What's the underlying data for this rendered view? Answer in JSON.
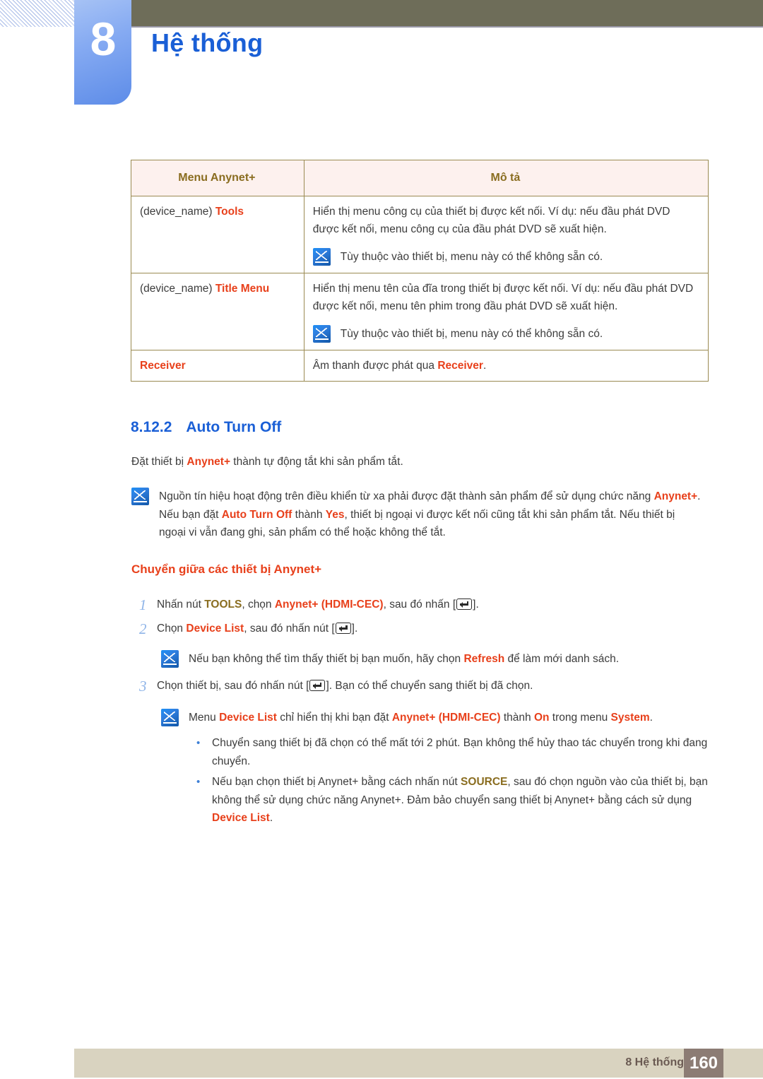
{
  "header": {
    "chapter_number": "8",
    "title": "Hệ thống",
    "accent_blue": "#1a5fd6",
    "chapter_box_color": "#85aaf2",
    "bar_color": "#6e6d59"
  },
  "table": {
    "headers": [
      "Menu Anynet+",
      "Mô tả"
    ],
    "rows": [
      {
        "label_plain": "(device_name) ",
        "label_kw": "Tools",
        "desc_main": "Hiển thị menu công cụ của thiết bị được kết nối. Ví dụ: nếu đầu phát DVD được kết nối, menu công cụ của đầu phát DVD sẽ xuất hiện.",
        "desc_note": "Tùy thuộc vào thiết bị, menu này có thể không sẵn có."
      },
      {
        "label_plain": "(device_name) ",
        "label_kw": "Title Menu",
        "desc_main": "Hiển thị menu tên của đĩa trong thiết bị được kết nối. Ví dụ: nếu đầu phát DVD được kết nối, menu tên phim trong đầu phát DVD sẽ xuất hiện.",
        "desc_note": "Tùy thuộc vào thiết bị, menu này có thể không sẵn có."
      },
      {
        "label_plain": "",
        "label_kw": "Receiver",
        "desc_pre": "Âm thanh được phát qua ",
        "desc_kw": "Receiver",
        "desc_post": "."
      }
    ]
  },
  "section": {
    "number": "8.12.2",
    "title": "Auto Turn Off",
    "intro_pre": "Đặt thiết bị ",
    "intro_kw": "Anynet+",
    "intro_post": " thành tự động tắt khi sản phẩm tắt.",
    "note": {
      "p1": "Nguồn tín hiệu hoạt động trên điều khiển từ xa phải được đặt thành sản phẩm để sử dụng chức năng ",
      "kw1": "Anynet+",
      "p2": ". Nếu bạn đặt ",
      "kw2": "Auto Turn Off",
      "p3": " thành ",
      "kw3": "Yes",
      "p4": ", thiết bị ngoại vi được kết nối cũng tắt khi sản phẩm tắt. Nếu thiết bị ngoại vi vẫn đang ghi, sản phẩm có thể hoặc không thể tắt."
    }
  },
  "subsection": {
    "title": "Chuyển giữa các thiết bị Anynet+",
    "steps": [
      {
        "number": "1",
        "pre": "Nhấn nút ",
        "kw_gold": "TOOLS",
        "mid": ", chọn ",
        "kw_orange": "Anynet+ (HDMI-CEC)",
        "post": ", sau đó nhấn [",
        "tail": "]."
      },
      {
        "number": "2",
        "pre": "Chọn ",
        "kw_orange": "Device List",
        "post": ", sau đó nhấn nút [",
        "tail": "]."
      },
      {
        "number": "3",
        "pre": "Chọn thiết bị, sau đó nhấn nút [",
        "post": "]. Bạn có thể chuyển sang thiết bị đã chọn.",
        "tail": ""
      }
    ],
    "note_after_step2": {
      "pre": "Nếu bạn không thể tìm thấy thiết bị bạn muốn, hãy chọn ",
      "kw": "Refresh",
      "post": " để làm mới danh sách."
    },
    "note_after_step3": {
      "pre": "Menu ",
      "kw1": "Device List",
      "mid1": " chỉ hiển thị khi bạn đặt ",
      "kw2": "Anynet+ (HDMI-CEC)",
      "mid2": " thành ",
      "kw3": "On",
      "mid3": " trong menu ",
      "kw4": "System",
      "post": "."
    },
    "bullets": [
      {
        "text": "Chuyển sang thiết bị đã chọn có thể mất tới 2 phút. Bạn không thể hủy thao tác chuyển trong khi đang chuyển."
      },
      {
        "pre": "Nếu bạn chọn thiết bị Anynet+ bằng cách nhấn nút ",
        "kw_gold": "SOURCE",
        "mid": ", sau đó chọn nguồn vào của thiết bị, bạn không thể sử dụng chức năng Anynet+. Đảm bảo chuyển sang thiết bị Anynet+ bằng cách sử dụng ",
        "kw_orange": "Device List",
        "post": "."
      }
    ]
  },
  "footer": {
    "chapter_label": "8 Hệ thống",
    "page_number": "160"
  }
}
